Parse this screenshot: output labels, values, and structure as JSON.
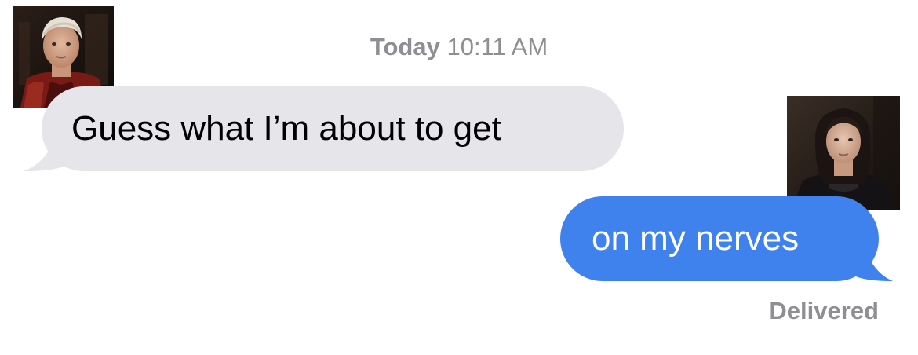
{
  "conversation": {
    "timestamp": {
      "day": "Today",
      "time": "10:11 AM"
    },
    "messages": [
      {
        "direction": "incoming",
        "text": "Guess what I’m about to get"
      },
      {
        "direction": "outgoing",
        "text": "on my nerves"
      }
    ],
    "delivery_status": "Delivered"
  },
  "colors": {
    "incoming_bubble": "#e5e5ea",
    "outgoing_bubble": "#3f82ee",
    "meta_text": "#8e8e93"
  },
  "avatars": [
    {
      "side": "left",
      "description_icon": "avatar-photo-man-red-coat"
    },
    {
      "side": "right",
      "description_icon": "avatar-photo-woman-dark-hair"
    }
  ]
}
